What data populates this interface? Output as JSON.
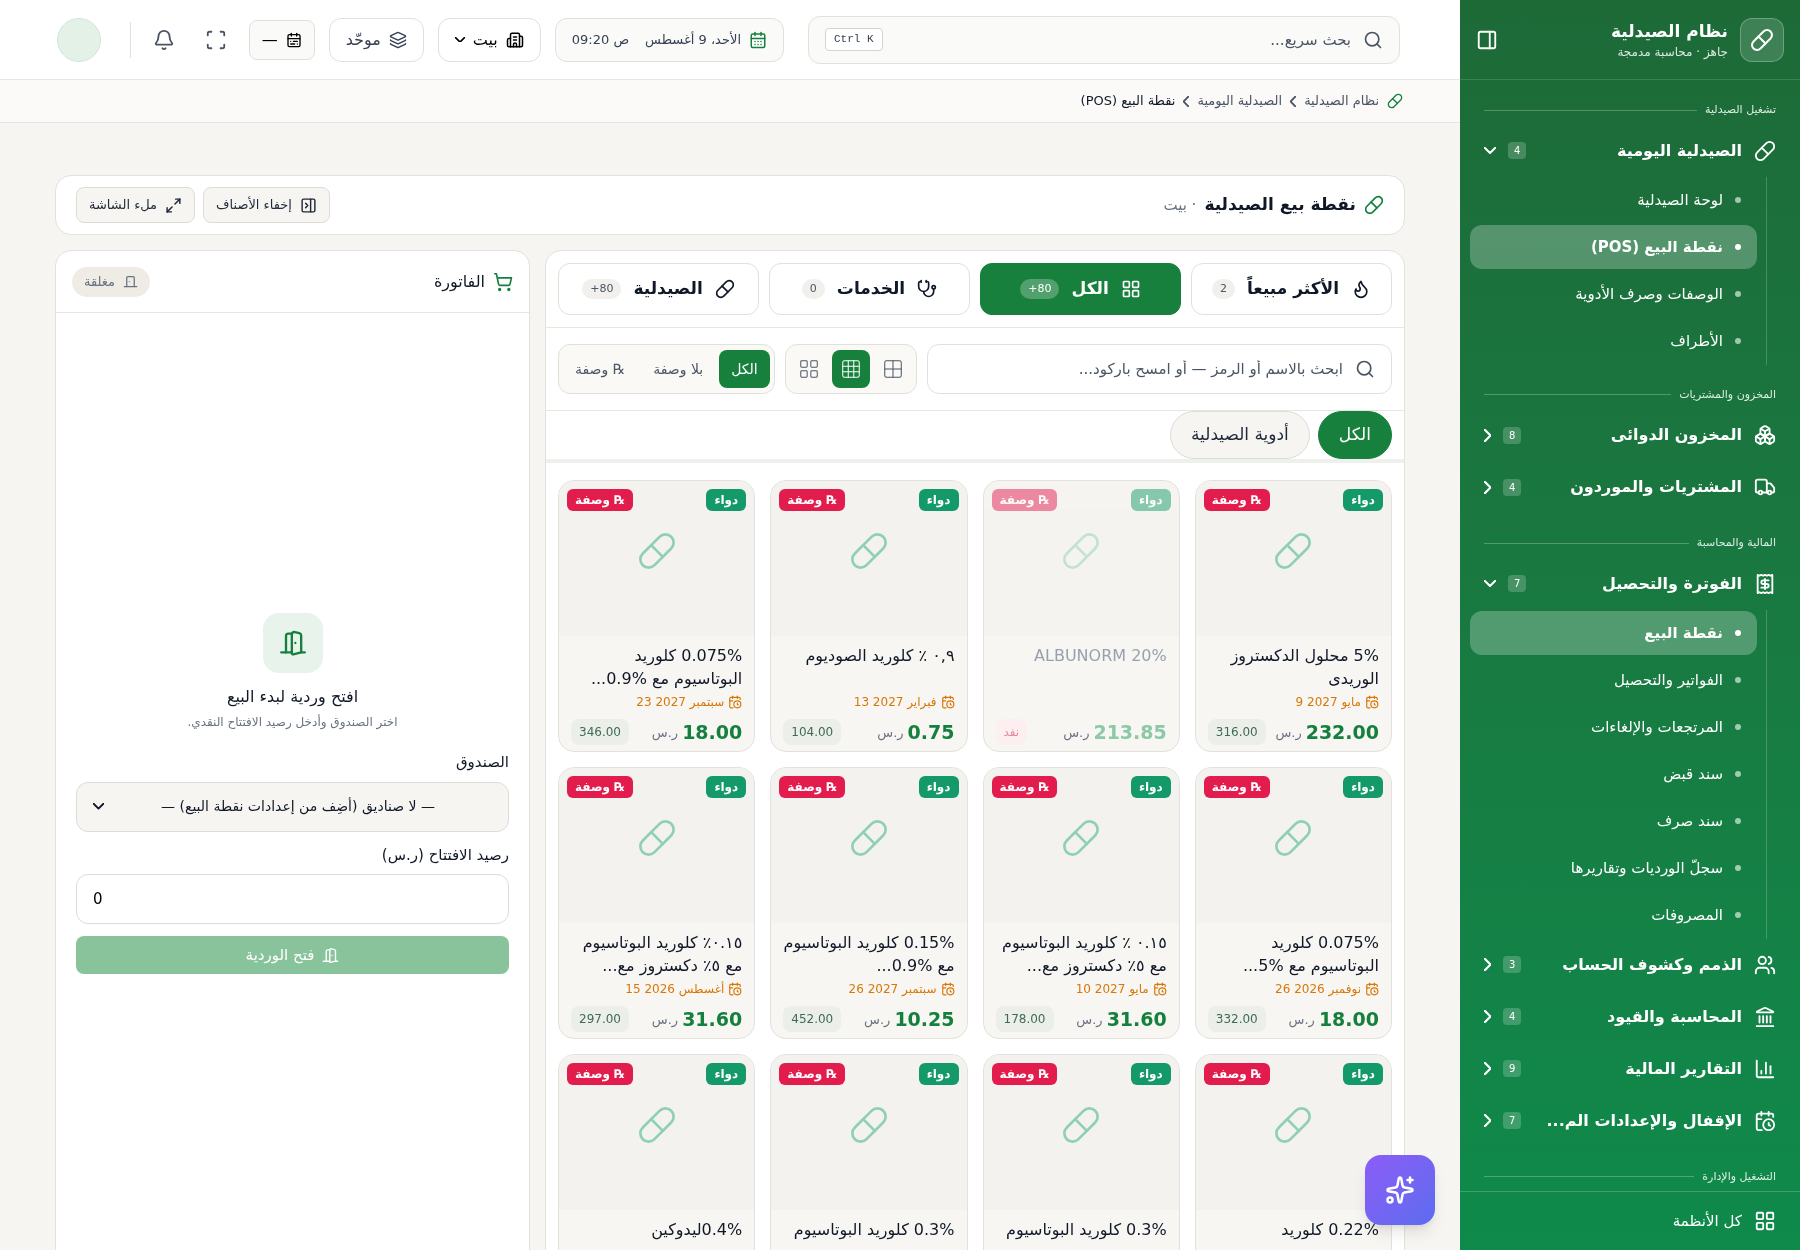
{
  "sidebar": {
    "title": "نظام الصيدلية",
    "subtitle": "جاهز · محاسبة مدمجة",
    "sections": [
      {
        "title": "تشغيل الصيدلية",
        "items": [
          {
            "label": "الصيدلية اليومية",
            "badge": "4",
            "expanded": true,
            "children": [
              {
                "label": "لوحة الصيدلية",
                "selected": false
              },
              {
                "label": "نقطة البيع (POS)",
                "selected": true
              },
              {
                "label": "الوصفات وصرف الأدوية",
                "selected": false
              },
              {
                "label": "الأطراف",
                "selected": false
              }
            ]
          }
        ]
      },
      {
        "title": "المخزون والمشتريات",
        "items": [
          {
            "label": "المخزون الدوائى",
            "badge": "8",
            "expanded": false
          },
          {
            "label": "المشتريات والموردون",
            "badge": "4",
            "expanded": false
          }
        ]
      },
      {
        "title": "المالية والمحاسبة",
        "items": [
          {
            "label": "الفوترة والتحصيل",
            "badge": "7",
            "expanded": true,
            "children": [
              {
                "label": "نقطة البيع",
                "selected": true
              },
              {
                "label": "الفواتير والتحصيل",
                "selected": false
              },
              {
                "label": "المرتجعات والإلغاءات",
                "selected": false
              },
              {
                "label": "سند قبض",
                "selected": false
              },
              {
                "label": "سند صرف",
                "selected": false
              },
              {
                "label": "سجلّ الورديات وتقاريرها",
                "selected": false
              },
              {
                "label": "المصروفات",
                "selected": false
              }
            ]
          },
          {
            "label": "الذمم وكشوف الحساب",
            "badge": "3",
            "expanded": false
          },
          {
            "label": "المحاسبة والقيود",
            "badge": "4",
            "expanded": false
          },
          {
            "label": "التقارير المالية",
            "badge": "9",
            "expanded": false
          },
          {
            "label": "الإقفال والإعدادات الم...",
            "badge": "7",
            "expanded": false
          }
        ]
      },
      {
        "title": "التشغيل والإدارة"
      }
    ],
    "footer": "كل الأنظمة"
  },
  "topbar": {
    "search": {
      "placeholder": "بحث سريع...",
      "shortcut": "Ctrl K"
    },
    "date": "الأحد، 9 أغسطس",
    "time": "ص 09:20",
    "branch": "بيت",
    "mode": "موحّد",
    "period": "—"
  },
  "breadcrumb": [
    "نظام الصيدلية",
    "الصيدلية اليومية",
    "نقطة البيع (POS)"
  ],
  "header": {
    "title": "نقطة بيع الصيدلية",
    "subtitle": "· بيت",
    "buttons": [
      "إخفاء الأصناف",
      "ملء الشاشة"
    ]
  },
  "tabs": [
    {
      "label": "الأكثر مبيعاً",
      "count": "2",
      "selected": false
    },
    {
      "label": "الكل",
      "count": "+80",
      "selected": true
    },
    {
      "label": "الخدمات",
      "count": "0",
      "selected": false
    },
    {
      "label": "الصيدلية",
      "count": "+80",
      "selected": false
    }
  ],
  "product_search": {
    "placeholder": "ابحث بالاسم أو الرمز — أو امسح باركود..."
  },
  "views": [
    {
      "selected": false
    },
    {
      "selected": true
    },
    {
      "selected": false
    }
  ],
  "filters": [
    {
      "label": "الكل",
      "selected": true
    },
    {
      "label": "بلا وصفة",
      "selected": false
    },
    {
      "label": "℞ وصفة",
      "selected": false
    }
  ],
  "categories": [
    {
      "label": "الكل",
      "selected": true
    },
    {
      "label": "أدوية الصيدلية",
      "selected": false
    }
  ],
  "products": [
    {
      "type": "دواء",
      "rx": "℞ وصفة",
      "name": "5% محلول الدكستروز الوريدى",
      "expiry": "مايو 2027 9",
      "price": "232.00",
      "currency": "ر.س",
      "stock": "316.00",
      "out_of_stock": false
    },
    {
      "type": "دواء",
      "rx": "℞ وصفة",
      "name": "ALBUNORM 20%",
      "price": "213.85",
      "currency": "ر.س",
      "stock": "نفد",
      "out_of_stock": true
    },
    {
      "type": "دواء",
      "rx": "℞ وصفة",
      "name": "٠,٩ ٪ كلوريد الصوديوم",
      "expiry": "فبراير 2027 13",
      "price": "0.75",
      "currency": "ر.س",
      "stock": "104.00",
      "out_of_stock": false
    },
    {
      "type": "دواء",
      "rx": "℞ وصفة",
      "name": "0.075% كلوريد البوتاسيوم مع %0.9...",
      "expiry": "سبتمبر 2027 23",
      "price": "18.00",
      "currency": "ر.س",
      "stock": "346.00",
      "out_of_stock": false
    },
    {
      "type": "دواء",
      "rx": "℞ وصفة",
      "name": "0.075% كلوريد البوتاسيوم مع %5...",
      "expiry": "نوفمبر 2026 26",
      "price": "18.00",
      "currency": "ر.س",
      "stock": "332.00",
      "out_of_stock": false
    },
    {
      "type": "دواء",
      "rx": "℞ وصفة",
      "name": "٠.١٥ ٪ كلوريد البوتاسيوم مع ٥٪ دكستروز مع...",
      "expiry": "مايو 2027 10",
      "price": "31.60",
      "currency": "ر.س",
      "stock": "178.00",
      "out_of_stock": false
    },
    {
      "type": "دواء",
      "rx": "℞ وصفة",
      "name": "0.15% كلوريد البوتاسيوم مع %0.9...",
      "expiry": "سبتمبر 2027 26",
      "price": "10.25",
      "currency": "ر.س",
      "stock": "452.00",
      "out_of_stock": false
    },
    {
      "type": "دواء",
      "rx": "℞ وصفة",
      "name": "٠.١٥٪ كلوريد البوتاسيوم مع ٥٪ دكستروز مع...",
      "expiry": "أغسطس 2026 15",
      "price": "31.60",
      "currency": "ر.س",
      "stock": "297.00",
      "out_of_stock": false
    },
    {
      "type": "دواء",
      "rx": "℞ وصفة",
      "name": "0.22% كلوريد",
      "out_of_stock": false
    },
    {
      "type": "دواء",
      "rx": "℞ وصفة",
      "name": "0.3% كلوريد البوتاسيوم",
      "out_of_stock": false
    },
    {
      "type": "دواء",
      "rx": "℞ وصفة",
      "name": "0.3% كلوريد البوتاسيوم",
      "out_of_stock": false
    },
    {
      "type": "دواء",
      "rx": "℞ وصفة",
      "name": "0.4%ليدوكين",
      "out_of_stock": false
    }
  ],
  "invoice": {
    "title": "الفاتورة",
    "status": "مغلقة",
    "empty_title": "افتح وردية لبدء البيع",
    "empty_hint": "اختر الصندوق وأدخل رصيد الافتتاح النقدي.",
    "box_label": "الصندوق",
    "box_value": "— لا صناديق (أضِف من إعدادات نقطة البيع) —",
    "opening_label": "رصيد الافتتاح (ر.س)",
    "opening_value": "0",
    "button": {
      "label": "فتح الوردية",
      "disabled": true
    }
  }
}
